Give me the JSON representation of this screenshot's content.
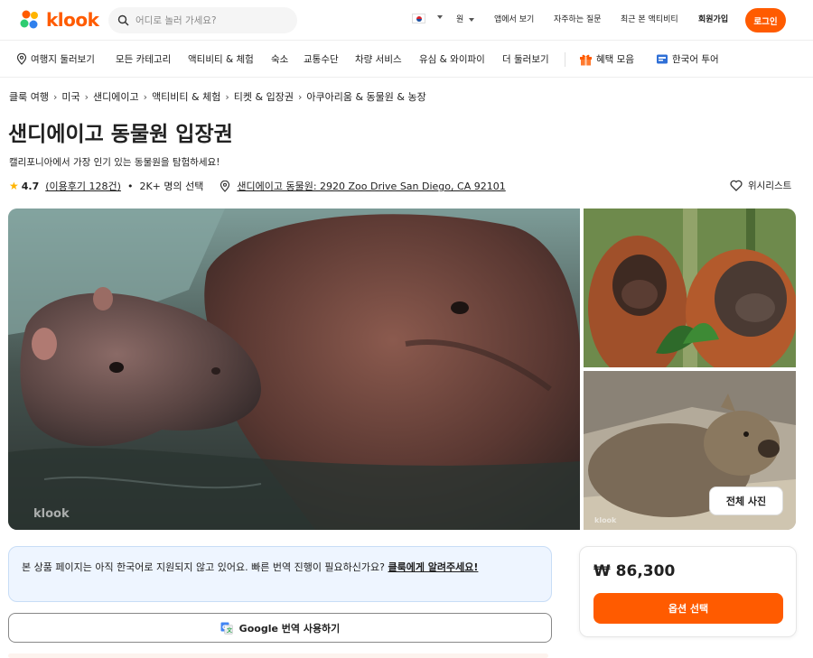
{
  "header": {
    "logo_text": "klook",
    "search_placeholder": "어디로 놀러 가세요?",
    "currency": "원",
    "nav": [
      "앱에서 보기",
      "자주하는 질문",
      "최근 본 액티비티",
      "회원가입"
    ],
    "login_label": "로그인"
  },
  "subnav": {
    "items": [
      "여행지 둘러보기",
      "모든 카테고리",
      "액티비티 & 체험",
      "숙소",
      "교통수단",
      "차량 서비스",
      "유심 & 와이파이",
      "더 둘러보기"
    ],
    "benefits": "혜택 모음",
    "korean_tour": "한국어 투어"
  },
  "breadcrumb": [
    "클룩 여행",
    "미국",
    "샌디에이고",
    "액티비티 & 체험",
    "티켓 & 입장권",
    "아쿠아리움 & 동물원 & 농장"
  ],
  "product": {
    "title": "샌디에이고 동물원 입장권",
    "subtitle": "캘리포니아에서 가장 인기 있는 동물원을 탐험하세요!",
    "rating": "4.7",
    "reviews": "(이용후기 128건)",
    "booked": "2K+ 명의 선택",
    "address": "샌디에이고 동물원: 2920 Zoo Drive San Diego, CA 92101",
    "wishlist": "위시리스트"
  },
  "gallery": {
    "all_photos": "전체 사진",
    "watermark": "klook"
  },
  "notice": {
    "text": "본 상품 페이지는 아직 한국어로 지원되지 않고 있어요. 빠른 번역 진행이 필요하신가요? ",
    "link": "클룩에게 알려주세요!"
  },
  "translate_label": "Google 번역 사용하기",
  "price": {
    "amount": "₩ 86,300",
    "select_label": "옵션 선택"
  },
  "colors": {
    "brand": "#ff5b00",
    "notice_bg": "#eef5ff",
    "star": "#ffb400"
  }
}
